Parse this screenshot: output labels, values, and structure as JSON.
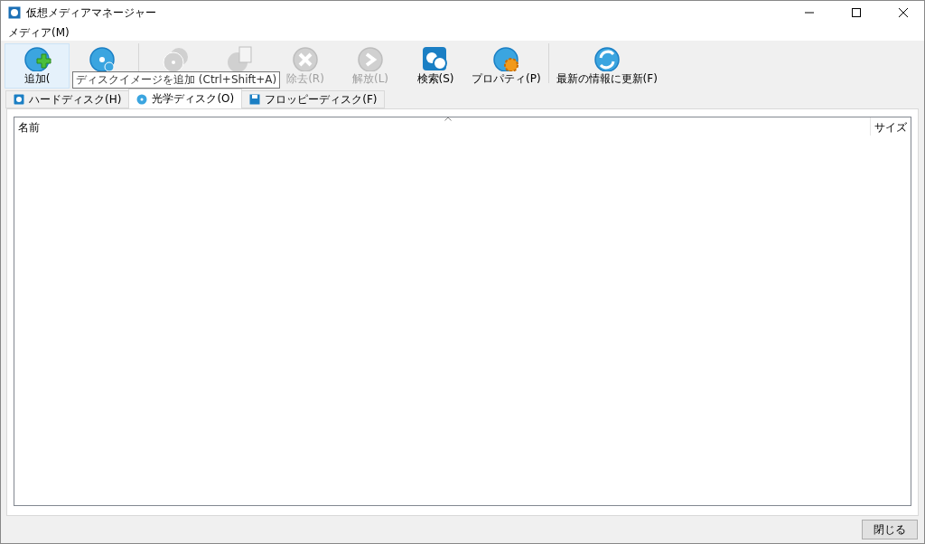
{
  "window": {
    "title": "仮想メディアマネージャー"
  },
  "menu": [
    "メディア(M)"
  ],
  "toolbar": [
    {
      "kind": "add",
      "label": "追加(",
      "disabled": false,
      "hovered": true
    },
    {
      "kind": "create",
      "disabled": false,
      "hovered": false
    },
    {
      "kind": "copy",
      "disabled": true,
      "hovered": false
    },
    {
      "kind": "move",
      "disabled": true,
      "hovered": false
    },
    {
      "kind": "remove",
      "label": "除去(R)",
      "disabled": true,
      "hovered": false
    },
    {
      "kind": "release",
      "label": "解放(L)",
      "disabled": true,
      "hovered": false
    },
    {
      "kind": "search",
      "label": "検索(S)",
      "disabled": false,
      "hovered": false
    },
    {
      "kind": "properties",
      "label": "プロパティ(P)",
      "disabled": false,
      "hovered": false
    },
    {
      "kind": "refresh",
      "label": "最新の情報に更新(F)",
      "disabled": false,
      "hovered": false
    }
  ],
  "tooltip": "ディスクイメージを追加 (Ctrl+Shift+A)",
  "tabs": [
    {
      "kind": "hdd",
      "label": "ハードディスク(H)",
      "selected": false
    },
    {
      "kind": "optical",
      "label": "光学ディスク(O)",
      "selected": true
    },
    {
      "kind": "floppy",
      "label": "フロッピーディスク(F)",
      "selected": false
    }
  ],
  "table": {
    "columns": [
      "名前",
      "サイズ"
    ]
  },
  "buttons": [
    "閉じる"
  ]
}
